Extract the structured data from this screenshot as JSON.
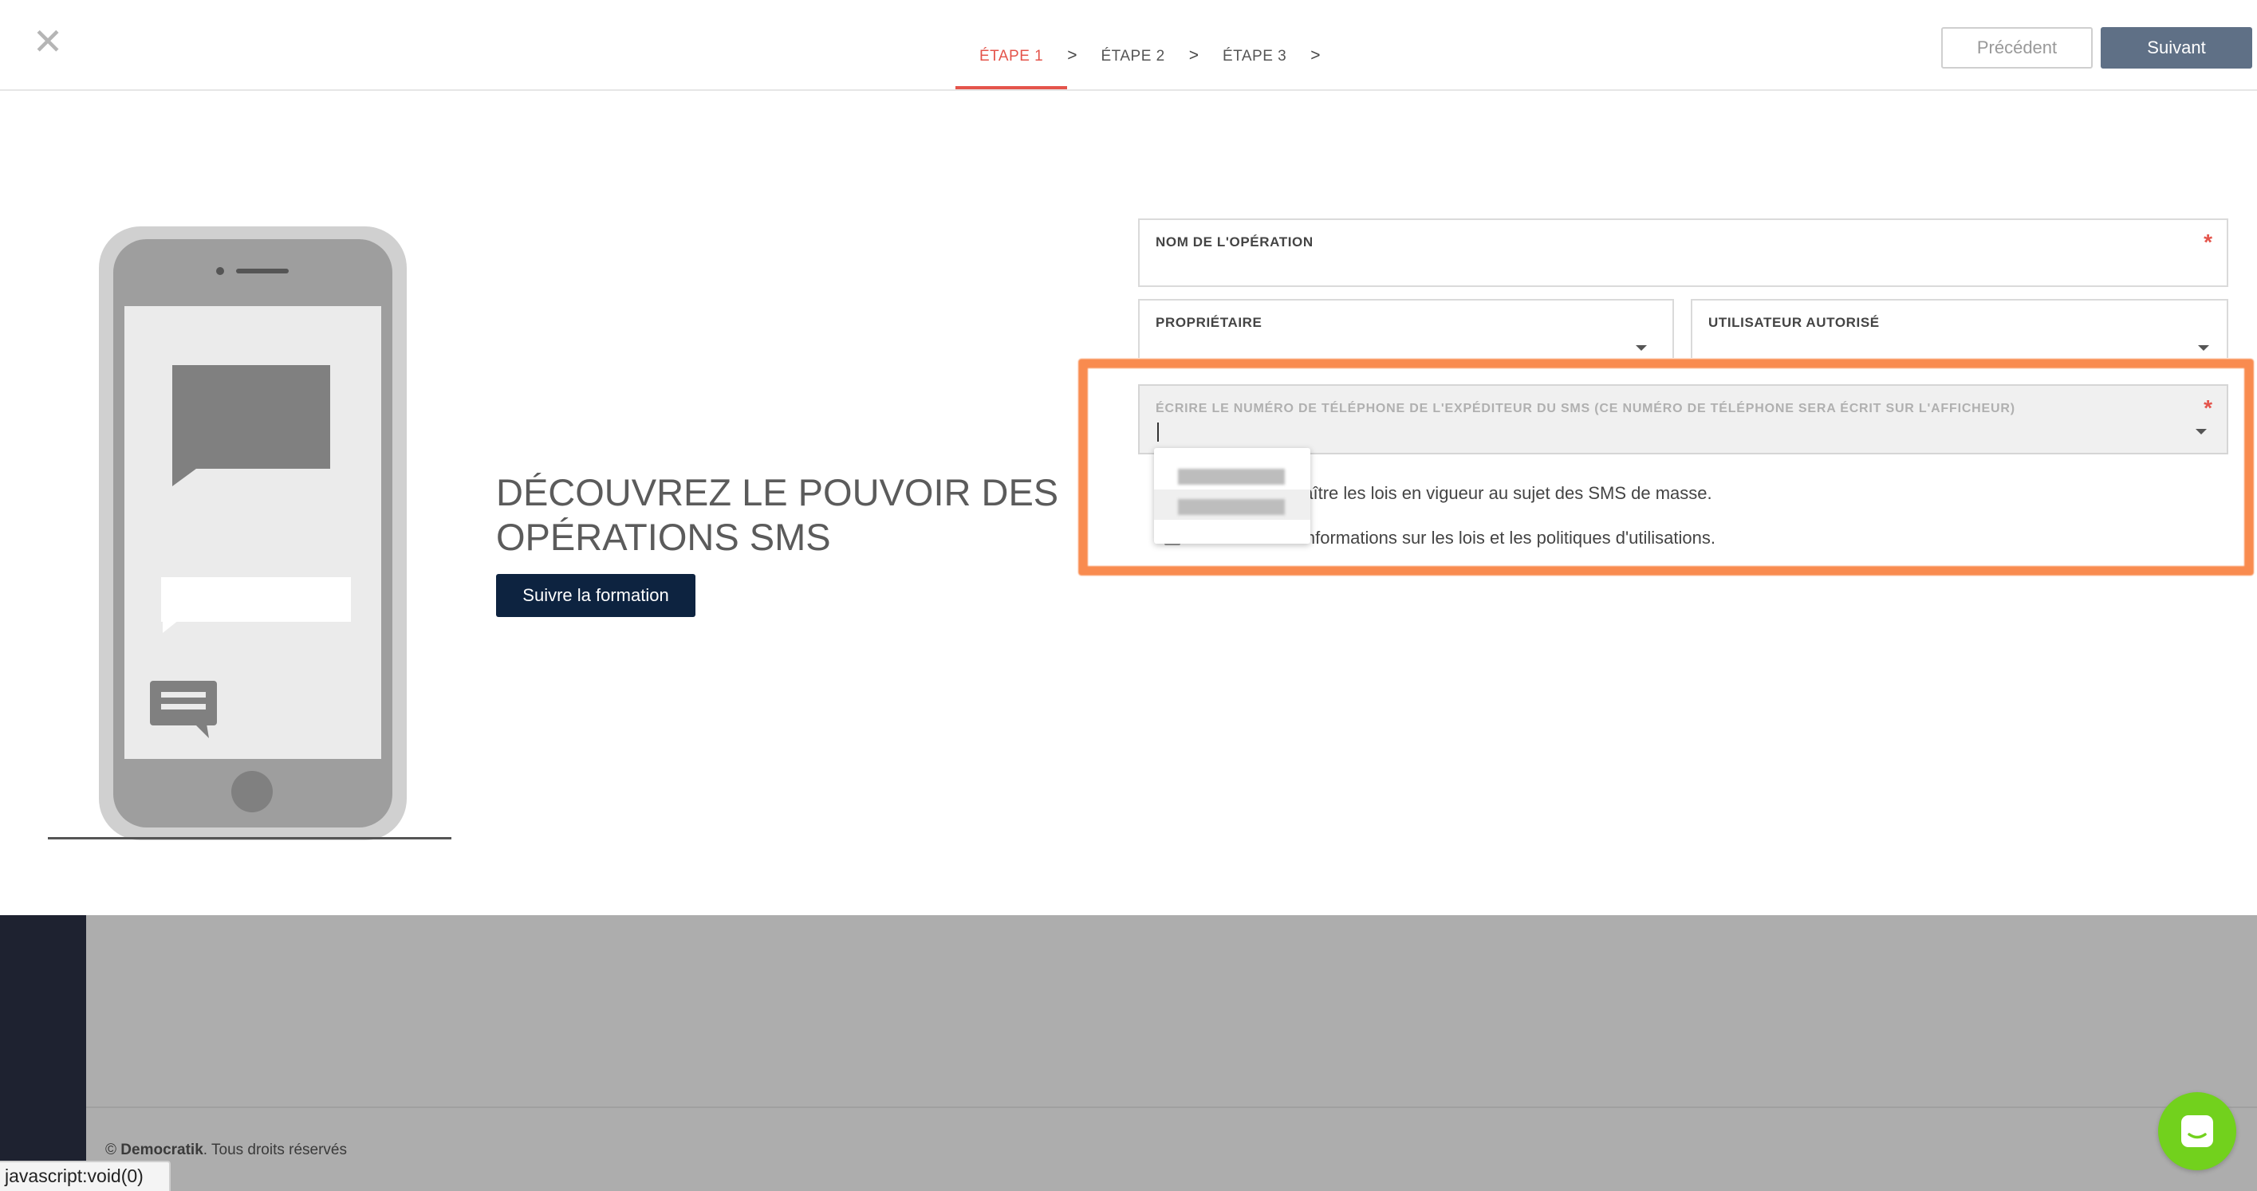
{
  "header": {
    "close_icon": "close-icon",
    "steps": [
      {
        "label": "ÉTAPE 1",
        "active": true
      },
      {
        "label": "ÉTAPE 2",
        "active": false
      },
      {
        "label": "ÉTAPE 3",
        "active": false
      }
    ],
    "step_separator": ">",
    "prev_label": "Précédent",
    "next_label": "Suivant"
  },
  "promo": {
    "title_line1": "DÉCOUVREZ LE POUVOIR DES",
    "title_line2": "OPÉRATIONS SMS",
    "button_label": "Suivre la formation",
    "illustration": "smartphone-sms-illustration"
  },
  "form": {
    "operation_name": {
      "label": "NOM DE L'OPÉRATION",
      "required_mark": "*",
      "value": ""
    },
    "owner": {
      "label": "PROPRIÉTAIRE",
      "value": ""
    },
    "authorized_user": {
      "label": "UTILISATEUR AUTORISÉ",
      "value": ""
    },
    "sender_phone": {
      "label": "ÉCRIRE LE NUMÉRO DE TÉLÉPHONE DE L'EXPÉDITEUR DU SMS (CE NUMÉRO DE TÉLÉPHONE SERA ÉCRIT SUR L'AFFICHEUR)",
      "required_mark": "*",
      "value": ""
    },
    "check1_text": "naître les lois en vigueur au sujet des SMS de masse.",
    "check2_text": "informations sur les lois et les politiques d'utilisations.",
    "dropdown_options": [
      "redacted-option-1",
      "redacted-option-2"
    ]
  },
  "colors": {
    "accent_red": "#e4544b",
    "next_button": "#5f7086",
    "promo_button": "#0d2340",
    "highlight": "#f9884a",
    "chat": "#72d11d"
  },
  "footer": {
    "copyright_symbol": "©",
    "brand": "Democratik",
    "rights": ". Tous droits réservés"
  },
  "status_bar": {
    "text": "javascript:void(0)"
  },
  "chat": {
    "icon": "chat-icon"
  }
}
